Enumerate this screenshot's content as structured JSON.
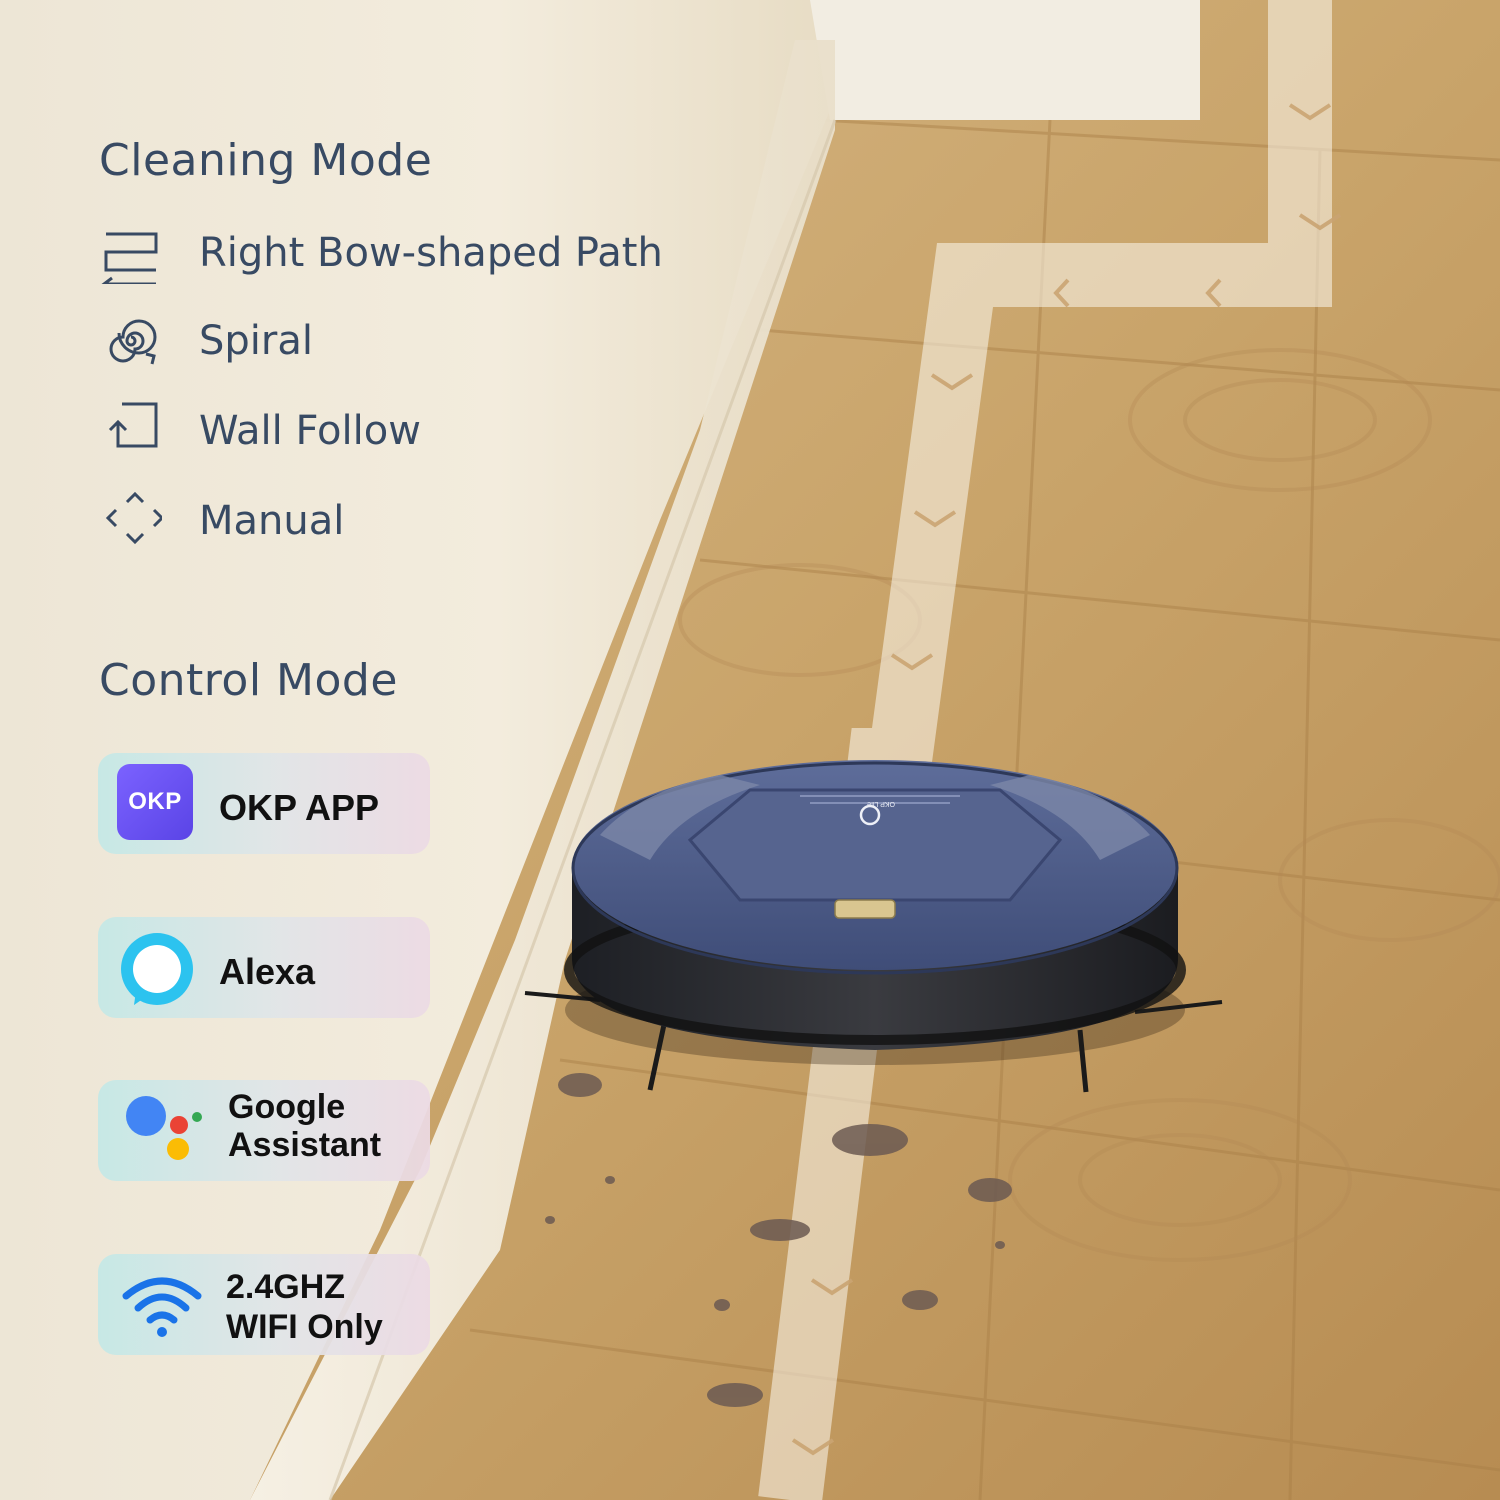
{
  "cleaning_mode": {
    "title": "Cleaning  Mode",
    "modes": [
      {
        "icon": "bow-path-icon",
        "label": "Right Bow-shaped Path"
      },
      {
        "icon": "spiral-icon",
        "label": "Spiral"
      },
      {
        "icon": "wall-follow-icon",
        "label": "Wall Follow"
      },
      {
        "icon": "manual-direction-icon",
        "label": "Manual"
      }
    ]
  },
  "control_mode": {
    "title": "Control Mode",
    "items": [
      {
        "icon": "okp-app-logo",
        "logo_text": "OKP",
        "label": "OKP APP"
      },
      {
        "icon": "alexa-icon",
        "label": "Alexa"
      },
      {
        "icon": "google-assistant-icon",
        "label_line1": "Google",
        "label_line2": "Assistant"
      },
      {
        "icon": "wifi-icon",
        "label_line1": "2.4GHZ",
        "label_line2": "WIFI Only"
      }
    ]
  },
  "robot": {
    "brand_text": "OKP Life"
  },
  "colors": {
    "text": "#384a63",
    "floor": "#c9a46a",
    "wall": "#f1e8d6",
    "robot_top": "#4f5f8e",
    "okp_logo": "#6a52f2",
    "alexa": "#2cc3ef",
    "google_blue": "#4285f4",
    "google_red": "#ea4335",
    "google_yellow": "#fbbc05",
    "google_green": "#34a853",
    "wifi": "#1a73e8"
  }
}
